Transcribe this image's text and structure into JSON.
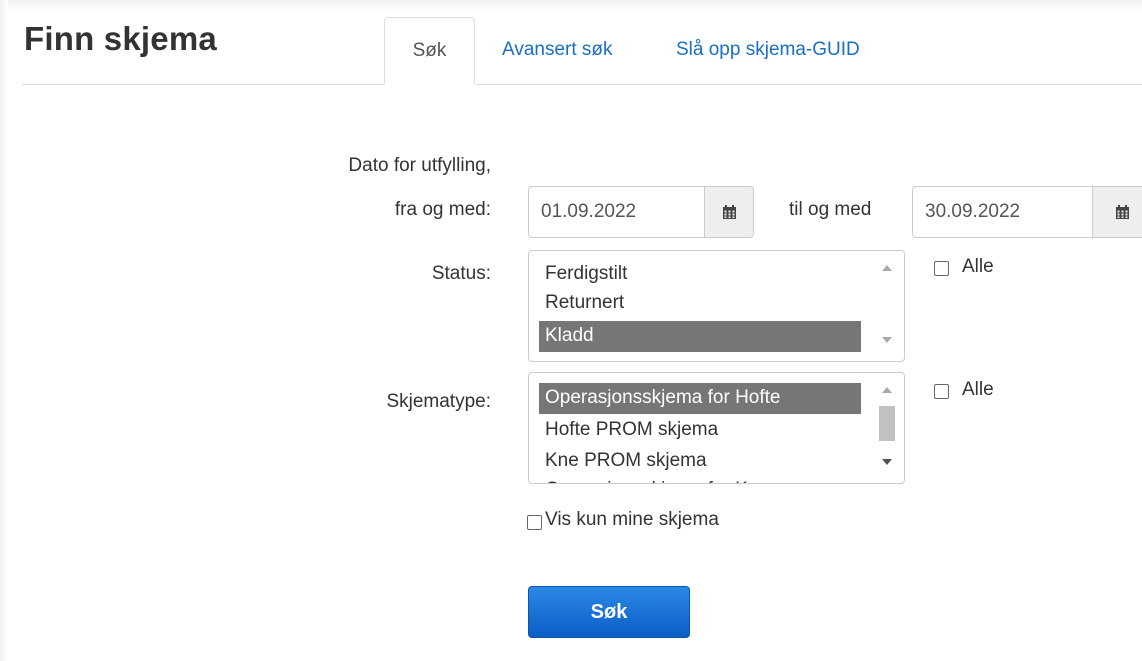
{
  "header": {
    "title": "Finn skjema",
    "tabs": [
      {
        "label": "Søk",
        "active": true
      },
      {
        "label": "Avansert søk",
        "active": false
      },
      {
        "label": "Slå opp skjema-GUID",
        "active": false
      }
    ]
  },
  "form": {
    "date": {
      "label_line1": "Dato for utfylling,",
      "label_line2": "fra og med:",
      "from_value": "01.09.2022",
      "to_label": "til og med",
      "to_value": "30.09.2022",
      "calendar_icon": "calendar-icon"
    },
    "status": {
      "label": "Status:",
      "options": [
        {
          "label": "Ferdigstilt",
          "selected": false
        },
        {
          "label": "Returnert",
          "selected": false
        },
        {
          "label": "Kladd",
          "selected": true
        }
      ],
      "all_label": "Alle",
      "all_checked": false
    },
    "form_type": {
      "label": "Skjematype:",
      "options": [
        {
          "label": "Operasjonsskjema for Hofte",
          "selected": true
        },
        {
          "label": "Hofte PROM skjema",
          "selected": false
        },
        {
          "label": "Kne PROM skjema",
          "selected": false
        },
        {
          "label": "Operasjonsskjema for Kne",
          "selected": false
        }
      ],
      "all_label": "Alle",
      "all_checked": false
    },
    "only_mine_label": "Vis kun mine skjema",
    "only_mine_checked": false,
    "search_button": "Søk"
  },
  "colors": {
    "link": "#1a6fc4",
    "selected_option_bg": "#767676",
    "button_blue": "#0a5ec6"
  }
}
